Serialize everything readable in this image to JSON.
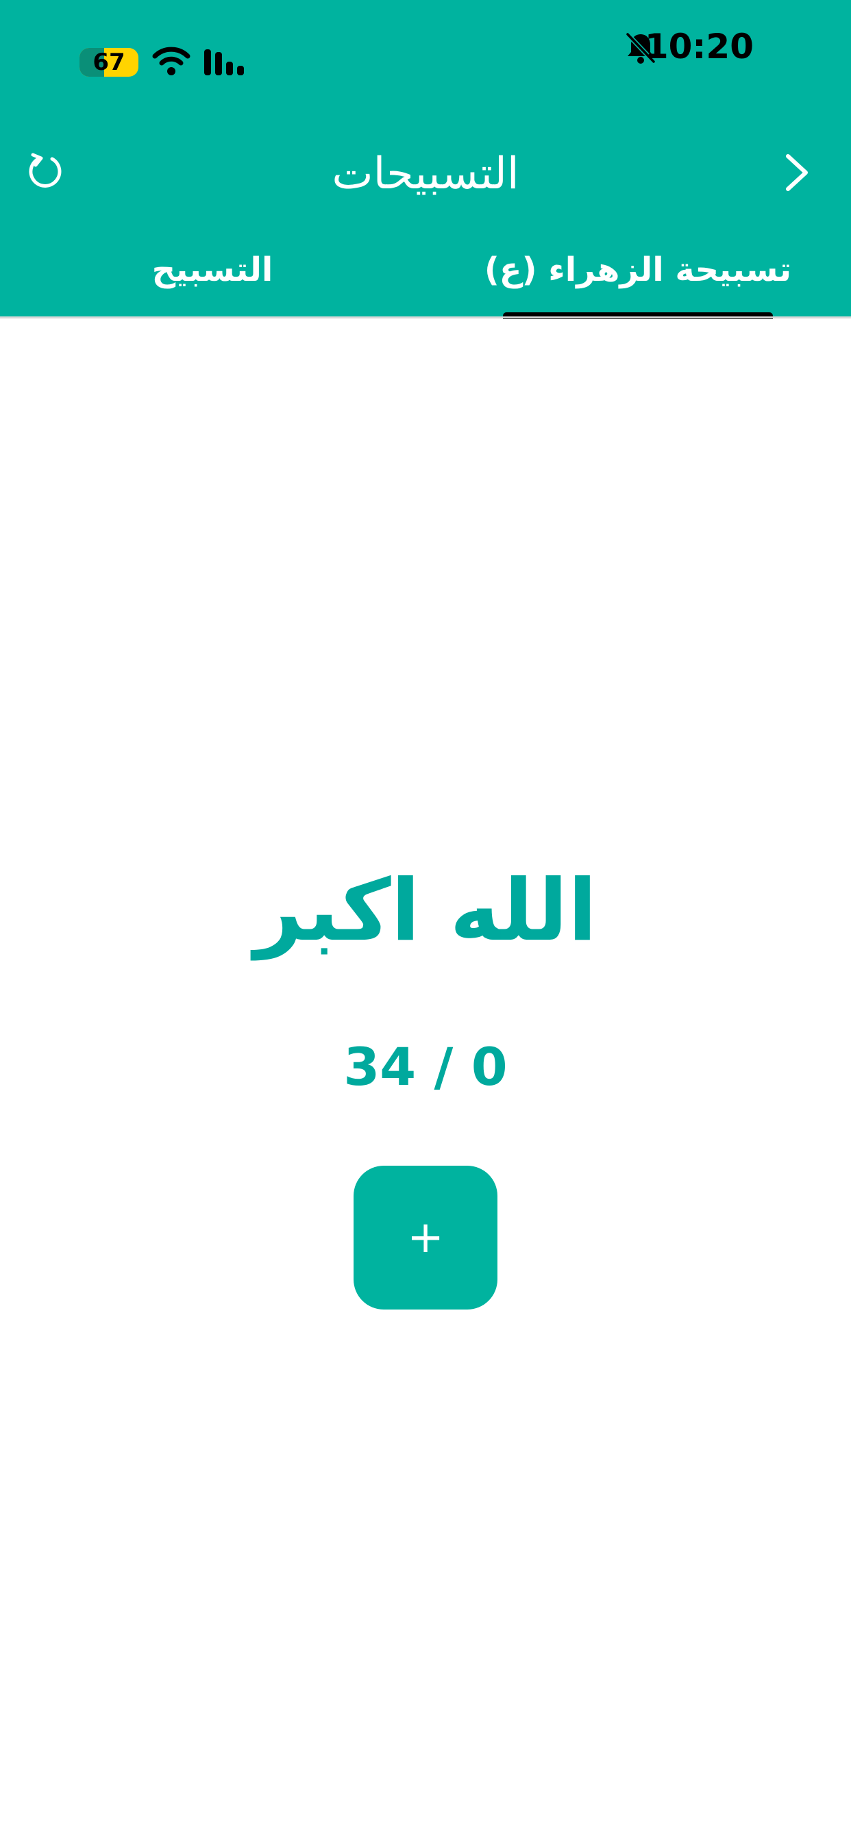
{
  "status_bar": {
    "time": "10:20",
    "battery_level": "67",
    "icons": [
      "bell-off-icon",
      "wifi-icon",
      "signal-icon"
    ]
  },
  "app_bar": {
    "title": "التسبيحات",
    "left_icon": "reset-icon",
    "right_icon": "chevron-right-icon"
  },
  "tabs": [
    {
      "label": "التسبيح",
      "selected": false
    },
    {
      "label": "تسبيحة الزهراء (ع)",
      "selected": true
    }
  ],
  "main": {
    "dhikr": "الله اكبر",
    "counter": "34 / 0",
    "increment_label": "+"
  },
  "colors": {
    "primary": "#00B39F",
    "text_accent": "#00A99D",
    "tab_indicator": "#000000",
    "background": "#ffffff"
  }
}
